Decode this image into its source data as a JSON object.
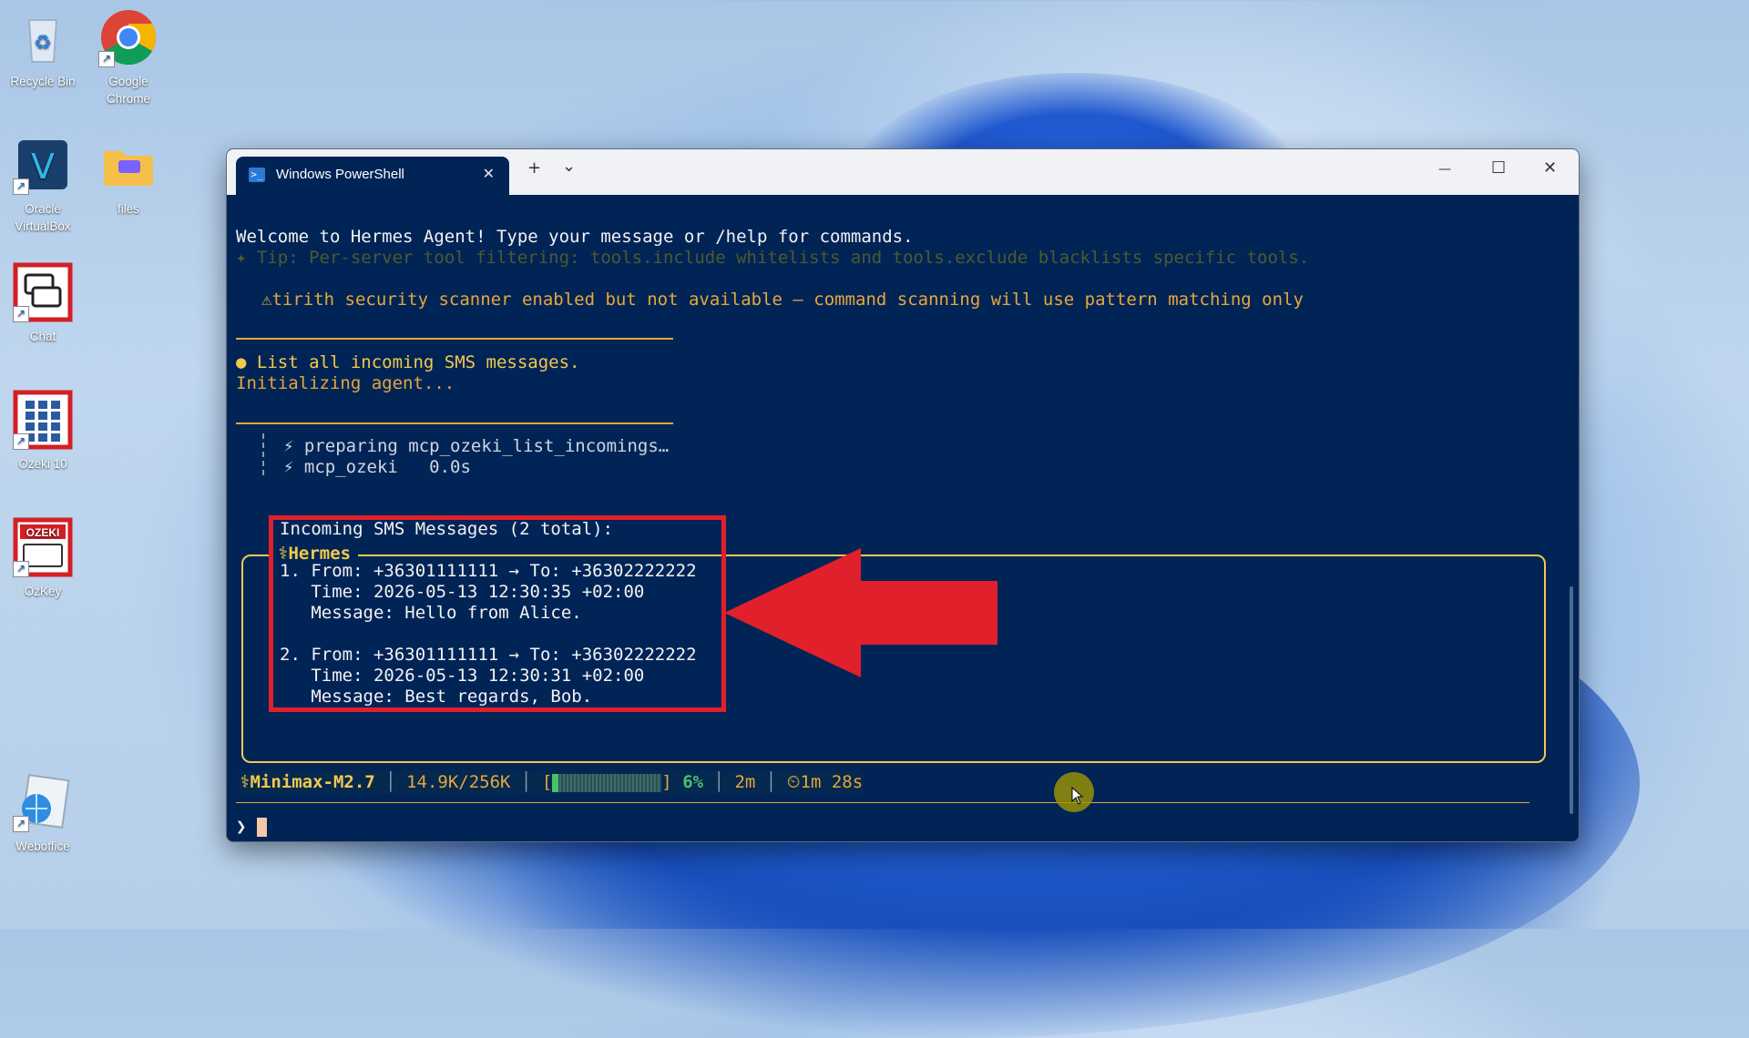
{
  "desktop": {
    "icons": [
      {
        "label": "Recycle Bin"
      },
      {
        "label": "Google Chrome"
      },
      {
        "label": "Oracle VirtualBox"
      },
      {
        "label": "files"
      },
      {
        "label": "Chat"
      },
      {
        "label": "Ozeki 10"
      },
      {
        "label": "OzKey"
      },
      {
        "label": "Weboffice"
      }
    ]
  },
  "window": {
    "tab_title": "Windows PowerShell",
    "new_tab": "+",
    "dropdown": "⌄",
    "minimize": "—",
    "maximize": "☐",
    "close": "✕"
  },
  "terminal": {
    "welcome": "Welcome to Hermes Agent! Type your message or /help for commands.",
    "tip": "✦ Tip: Per-server tool filtering: tools.include whitelists and tools.exclude blacklists specific tools.",
    "warning": "⚠tirith security scanner enabled but not available — command scanning will use pattern matching only",
    "user_prompt": "● List all incoming SMS messages.",
    "initializing": "Initializing agent...",
    "tool_line1": "⚡ preparing mcp_ozeki_list_incomings…",
    "tool_line2": "⚡ mcp_ozeki   0.0s",
    "hermes_title": "⚕Hermes",
    "response": {
      "heading": "Incoming SMS Messages (2 total):",
      "m1_from": "1. From: +36301111111 → To: +36302222222",
      "m1_time": "   Time: 2026-05-13 12:30:35 +02:00",
      "m1_msg": "   Message: Hello from Alice.",
      "m2_from": "2. From: +36301111111 → To: +36302222222",
      "m2_time": "   Time: 2026-05-13 12:30:31 +02:00",
      "m2_msg": "   Message: Best regards, Bob."
    },
    "status": {
      "model": "⚕Minimax-M2.7",
      "sep": "│",
      "tokens": "14.9K/256K",
      "bar_open": "[",
      "bar_close": "]",
      "percent": "6%",
      "percent_value": 0.06,
      "elapsed": "2m",
      "timer": "⏲1m 28s"
    },
    "prompt_symbol": "❯"
  },
  "colors": {
    "terminal_bg": "#012456",
    "accent_orange": "#e5a73b",
    "hermes_gold": "#f2c94c",
    "annotation_red": "#e0202a"
  }
}
